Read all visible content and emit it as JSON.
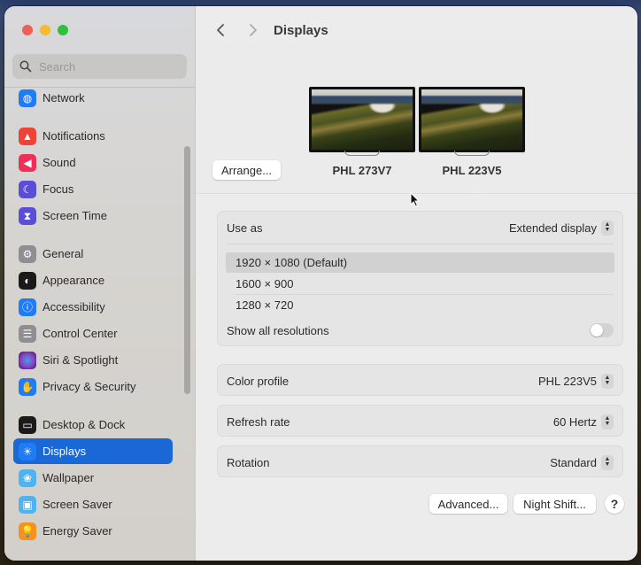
{
  "window": {
    "traffic_lights": [
      "close",
      "minimize",
      "maximize"
    ]
  },
  "sidebar": {
    "search_placeholder": "Search",
    "active_item": "Displays",
    "items": [
      {
        "label": "Network",
        "icon": "globe-icon",
        "color": "#1f7cf5"
      },
      {
        "label": "Notifications",
        "icon": "bell-icon",
        "color": "#ee4437"
      },
      {
        "label": "Sound",
        "icon": "speaker-icon",
        "color": "#ee2f57"
      },
      {
        "label": "Focus",
        "icon": "moon-icon",
        "color": "#5a4ed8"
      },
      {
        "label": "Screen Time",
        "icon": "hourglass-icon",
        "color": "#5a4ed8"
      },
      {
        "label": "General",
        "icon": "gear-icon",
        "color": "#8e8e93"
      },
      {
        "label": "Appearance",
        "icon": "appearance-icon",
        "color": "#1a1a1a"
      },
      {
        "label": "Accessibility",
        "icon": "accessibility-icon",
        "color": "#1f7cf5"
      },
      {
        "label": "Control Center",
        "icon": "toggles-icon",
        "color": "#8e8e93"
      },
      {
        "label": "Siri & Spotlight",
        "icon": "siri-icon",
        "color": "#6a3aa8"
      },
      {
        "label": "Privacy & Security",
        "icon": "hand-icon",
        "color": "#1f7cf5"
      },
      {
        "label": "Desktop & Dock",
        "icon": "dock-icon",
        "color": "#1a1a1a"
      },
      {
        "label": "Displays",
        "icon": "sun-icon",
        "color": "#1f7cf5"
      },
      {
        "label": "Wallpaper",
        "icon": "flower-icon",
        "color": "#4fb3f0"
      },
      {
        "label": "Screen Saver",
        "icon": "screensaver-icon",
        "color": "#4fb3f0"
      },
      {
        "label": "Energy Saver",
        "icon": "lightbulb-icon",
        "color": "#f5911f"
      }
    ]
  },
  "header": {
    "title": "Displays",
    "back_label": "Back",
    "forward_label": "Forward"
  },
  "displays": {
    "arrange_label": "Arrange...",
    "monitors": [
      {
        "name": "PHL 273V7",
        "selected": false
      },
      {
        "name": "PHL 223V5",
        "selected": true
      }
    ]
  },
  "settings": {
    "use_as": {
      "label": "Use as",
      "value": "Extended display"
    },
    "resolutions": [
      {
        "label": "1920 × 1080 (Default)",
        "selected": true
      },
      {
        "label": "1600 × 900",
        "selected": false
      },
      {
        "label": "1280 × 720",
        "selected": false
      }
    ],
    "show_all_resolutions": {
      "label": "Show all resolutions",
      "on": false
    },
    "color_profile": {
      "label": "Color profile",
      "value": "PHL 223V5"
    },
    "refresh_rate": {
      "label": "Refresh rate",
      "value": "60 Hertz"
    },
    "rotation": {
      "label": "Rotation",
      "value": "Standard"
    }
  },
  "footer": {
    "advanced_label": "Advanced...",
    "night_shift_label": "Night Shift...",
    "help_label": "?"
  },
  "colors": {
    "accent": "#1a67d6"
  }
}
